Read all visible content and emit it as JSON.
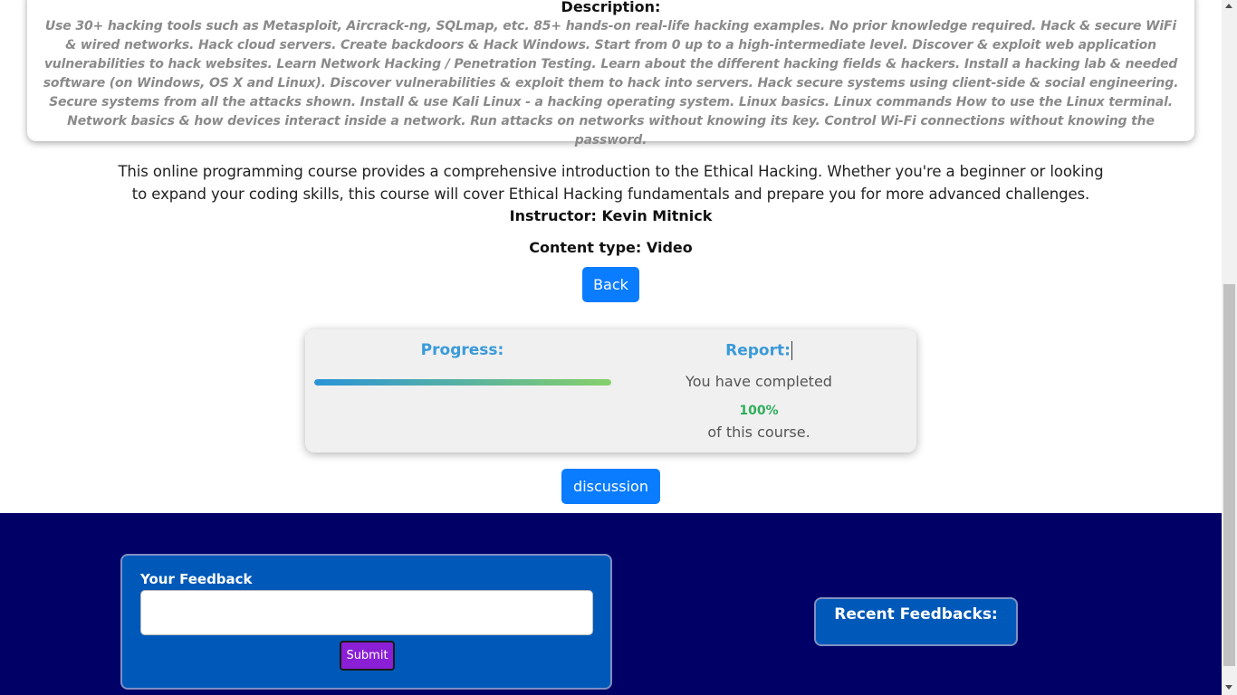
{
  "description": {
    "title": "Description:",
    "text": "Use 30+ hacking tools such as Metasploit, Aircrack-ng, SQLmap, etc. 85+ hands-on real-life hacking examples. No prior knowledge required. Hack & secure WiFi & wired networks. Hack cloud servers. Create backdoors & Hack Windows. Start from 0 up to a high-intermediate level. Discover & exploit web application vulnerabilities to hack websites. Learn Network Hacking / Penetration Testing. Learn about the different hacking fields & hackers. Install a hacking lab & needed software (on Windows, OS X and Linux). Discover vulnerabilities & exploit them to hack into servers. Hack secure systems using client-side & social engineering. Secure systems from all the attacks shown. Install & use Kali Linux - a hacking operating system. Linux basics. Linux commands How to use the Linux terminal. Network basics & how devices interact inside a network. Run attacks on networks without knowing its key. Control Wi-Fi connections without knowing the password."
  },
  "course": {
    "intro": "This online programming course provides a comprehensive introduction to the Ethical Hacking. Whether you're a beginner or looking to expand your coding skills, this course will cover Ethical Hacking fundamentals and prepare you for more advanced challenges.",
    "instructor": "Instructor: Kevin Mitnick",
    "content_type": "Content type: Video",
    "back_label": "Back",
    "discussion_label": "discussion"
  },
  "progress": {
    "title": "Progress:",
    "value_percent": 100,
    "bar_colors": [
      "#2a93d8",
      "#86d06a"
    ]
  },
  "report": {
    "title": "Report:",
    "line1": "You have completed",
    "percent": "100%",
    "line2": "of this course."
  },
  "feedback": {
    "label": "Your Feedback",
    "input_value": "",
    "submit_label": "Submit",
    "recent_title": "Recent Feedbacks:"
  },
  "colors": {
    "accent_blue": "#0a7cff",
    "heading_blue": "#3a9ad9",
    "footer_bg": "#000066",
    "feedback_box": "#0059b8",
    "submit_purple": "#8a1fd6",
    "percent_green": "#2fae5b"
  }
}
